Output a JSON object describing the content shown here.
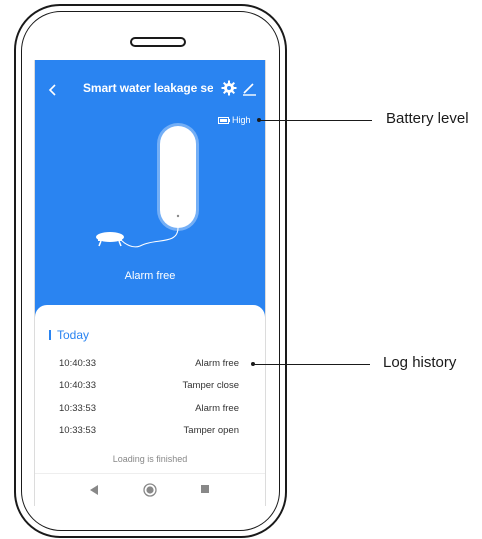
{
  "header": {
    "title": "Smart water leakage sens...",
    "back_icon": "chevron-left-icon",
    "settings_icon": "gear-icon",
    "edit_icon": "pencil-icon"
  },
  "battery": {
    "level_label": "High",
    "icon": "battery-icon"
  },
  "device": {
    "status": "Alarm free"
  },
  "log": {
    "section_title": "Today",
    "entries": [
      {
        "time": "10:40:33",
        "event": "Alarm free"
      },
      {
        "time": "10:40:33",
        "event": "Tamper close"
      },
      {
        "time": "10:33:53",
        "event": "Alarm free"
      },
      {
        "time": "10:33:53",
        "event": "Tamper open"
      }
    ],
    "footer": "Loading is finished"
  },
  "callouts": {
    "battery": "Battery level",
    "log": "Log history"
  },
  "colors": {
    "accent": "#2a84f1",
    "outline": "#1a1a1a"
  }
}
